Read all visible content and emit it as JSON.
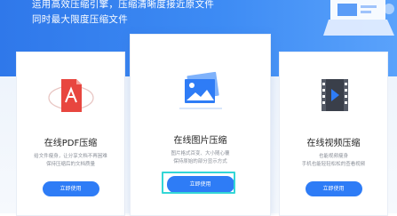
{
  "hero": {
    "line1": "运用高效压缩引擎，压缩清晰度接近原文件",
    "line2": "同时最大限度压缩文件"
  },
  "cards": [
    {
      "title": "在线PDF压缩",
      "desc1": "给文件瘦身，让分享文档不再困难",
      "desc2": "保持压缩后的文档质量",
      "button": "立即使用"
    },
    {
      "title": "在线图片压缩",
      "desc1": "图片格式百变、大小随心覆",
      "desc2": "保持原始的部分显示方式",
      "button": "立即使用"
    },
    {
      "title": "在线视频压缩",
      "desc1": "也能视频瘦身",
      "desc2": "手机也能轻轻松松的查看视频",
      "button": "立即使用"
    }
  ],
  "colors": {
    "accent": "#2e7cf6",
    "highlight": "#33d6d6",
    "pdf": "#e8463f"
  }
}
